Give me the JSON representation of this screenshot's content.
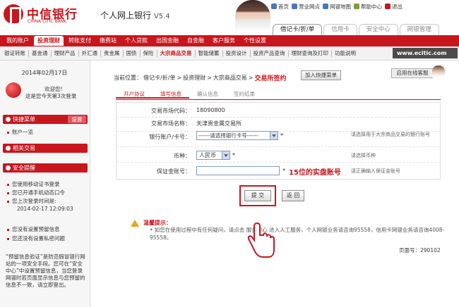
{
  "header": {
    "bank_name_cn": "中信银行",
    "bank_name_en": "CHINA CITIC BANK",
    "product": "个人网上银行",
    "version": "V5.4",
    "top_links": [
      "首页",
      "营业网点",
      "网银地图",
      "帮助中心",
      "退出"
    ],
    "product_tabs": [
      "借记卡/折/单",
      "信用卡",
      "安全中心",
      "网银管理"
    ]
  },
  "nav": {
    "items": [
      "我的账户",
      "投资理财",
      "转账支付",
      "缴费站",
      "个人贷款",
      "出国金融",
      "自金融",
      "客户服务",
      "个性设置"
    ],
    "active": "投资理财"
  },
  "subnav": {
    "items": [
      "银证转账",
      "基金通",
      "理财产品",
      "外汇通",
      "贵金属",
      "国债",
      "保险",
      "大宗商品交易",
      "智能储蓄",
      "投资设计",
      "投资产品查询",
      "理财查询及打印",
      "功能说明"
    ],
    "highlight": "大宗商品交易",
    "url": "www.ecitic.com"
  },
  "sidebar": {
    "date": "2014年02月17日",
    "welcome_line1": "欢迎您!",
    "welcome_line2": "这是您今天第3次登录",
    "quick_menu": "快捷菜单",
    "settings": "设置",
    "quick_items": [
      "账户一览"
    ],
    "related": "相关交易",
    "security": "安全提醒",
    "security_items": [
      "您使用移动证书登录",
      "您已开通手机动态口令",
      "您上次登录时间是:"
    ],
    "last_login": "2014-02-17 12:09:03",
    "security_items2": [
      "您没有设置预留信息",
      "您还没有设置私密问题"
    ],
    "note": "“预留信息验证”是防范假冒银行网站的一项安全手段。您可在“安全中心”中设置预留信息，当您登录网银时若页面显示信息与您预留的信息不一致，请立即登出。"
  },
  "breadcrumb": {
    "prefix": "当前位置：",
    "items": [
      "借记卡/折/单",
      ">",
      "投资理财",
      ">",
      "大宗商品交易",
      ">"
    ],
    "current": "交易所签约",
    "add_quick": "加入快捷菜单",
    "online_service": "启用在线客服"
  },
  "steps": {
    "items": [
      "开户协议",
      "填写信息",
      "确认信息",
      "签约结果"
    ],
    "done": [
      "开户协议",
      "填写信息"
    ]
  },
  "form": {
    "market_code_label": "交易市场代码：",
    "market_code": "18090800",
    "market_name_label": "交易市场名称：",
    "market_name": "天津贵金属交易所",
    "account_label": "银行账户/卡号：",
    "account_placeholder": "------请选择银行卡号------",
    "account_hint": "请选择用于大宗商品交易的银行账号",
    "currency_label": "币种：",
    "currency": "人民币",
    "currency_hint": "请选择币种",
    "margin_label": "保证金账号：",
    "margin_value": "",
    "margin_hint": "请正确输入保证金账号",
    "required_mark": "*"
  },
  "annotation": "15位的实盘账号",
  "buttons": {
    "submit": "提 交",
    "back": "返 回"
  },
  "tips": {
    "title": "温馨提示：",
    "text": "• 如您在使用过程中有任何疑问，请点击 服务中心 进入人工服务，个人网银业务请咨询95558，信用卡网银业务请咨询4008-95558。"
  },
  "page_number": "页面号：290102",
  "colors": {
    "brand_red": "#c8161d",
    "sub_bg": "#f2f2f2"
  },
  "icons": {
    "pointer": "hand-pointer-icon",
    "warning": "warning-icon"
  }
}
